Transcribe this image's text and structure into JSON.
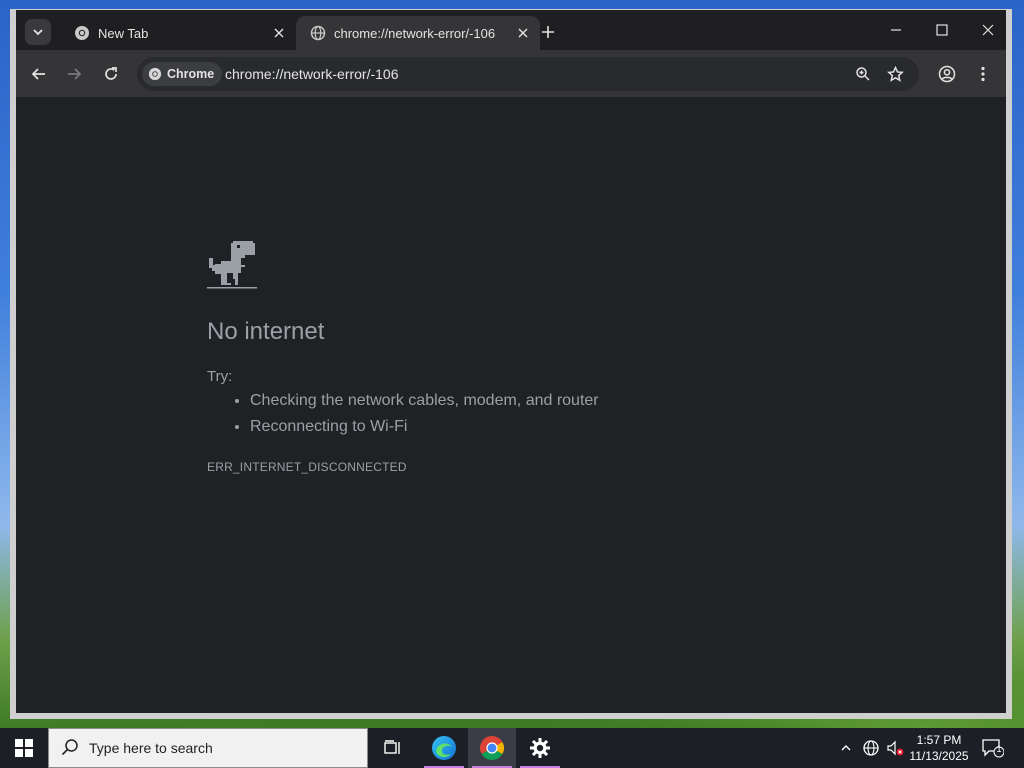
{
  "browser": {
    "tabs": [
      {
        "title": "New Tab",
        "icon": "chrome-icon",
        "active": false
      },
      {
        "title": "chrome://network-error/-106",
        "icon": "globe-icon",
        "active": true
      }
    ],
    "omnibox": {
      "chip_label": "Chrome",
      "url": "chrome://network-error/-106"
    }
  },
  "error_page": {
    "title": "No internet",
    "try_label": "Try:",
    "suggestions": [
      "Checking the network cables, modem, and router",
      "Reconnecting to Wi-Fi"
    ],
    "error_code": "ERR_INTERNET_DISCONNECTED"
  },
  "taskbar": {
    "search_placeholder": "Type here to search",
    "apps": [
      "task-view-icon",
      "edge-icon",
      "chrome-icon",
      "settings-icon"
    ],
    "clock": {
      "time": "1:57 PM",
      "date": "11/13/2025"
    },
    "notification_count": "1"
  },
  "colors": {
    "page_bg": "#202124",
    "toolbar_bg": "#353538",
    "text_muted": "#9aa0a6"
  }
}
